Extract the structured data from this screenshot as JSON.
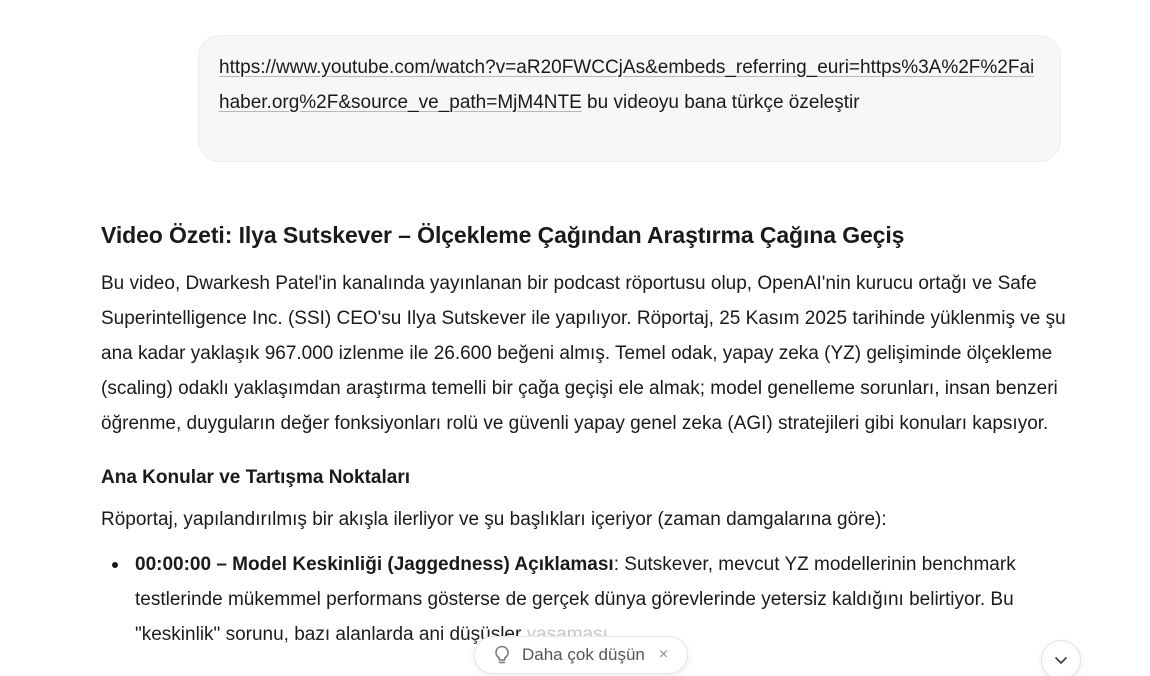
{
  "user_message": {
    "link_text": "https://www.youtube.com/watch?v=aR20FWCCjAs&embeds_referring_euri=https%3A%2F%2Faihaber.org%2F&source_ve_path=MjM4NTE",
    "text": " bu videoyu bana türkçe özeleştir"
  },
  "answer": {
    "title": "Video Özeti: Ilya Sutskever – Ölçekleme Çağından Araştırma Çağına Geçiş",
    "intro": "Bu video, Dwarkesh Patel'in kanalında yayınlanan bir podcast röportusu olup, OpenAI'nin kurucu ortağı ve Safe Superintelligence Inc. (SSI) CEO'su Ilya Sutskever ile yapılıyor. Röportaj, 25 Kasım 2025 tarihinde yüklenmiş ve şu ana kadar yaklaşık 967.000 izlenme ile 26.600 beğeni almış. Temel odak, yapay zeka (YZ) gelişiminde ölçekleme (scaling) odaklı yaklaşımdan araştırma temelli bir çağa geçişi ele almak; model genelleme sorunları, insan benzeri öğrenme, duyguların değer fonksiyonları rolü ve güvenli yapay genel zeka (AGI) stratejileri gibi konuları kapsıyor.",
    "section_heading": "Ana Konular ve Tartışma Noktaları",
    "section_intro": "Röportaj, yapılandırılmış bir akışla ilerliyor ve şu başlıkları içeriyor (zaman damgalarına göre):",
    "bullets": [
      {
        "title": "00:00:00 – Model Keskinliği (Jaggedness) Açıklaması",
        "text_main": ": Sutskever, mevcut YZ modellerinin benchmark testlerinde mükemmel performans gösterse de gerçek dünya görevlerinde yetersiz kaldığını belirtiyor. Bu \"keskinlik\" sorunu, bazı alanlarda ani düşüşler",
        "text_faded": " yaşaması"
      }
    ]
  },
  "suggestion_chip": {
    "icon": "lightbulb-icon",
    "label": "Daha çok düşün",
    "close_glyph": "×"
  },
  "scroll_button": {
    "icon": "chevron-down-icon"
  }
}
